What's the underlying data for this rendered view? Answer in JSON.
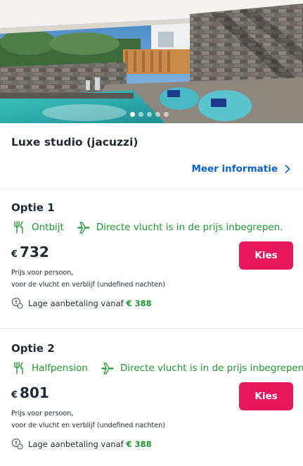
{
  "hero": {
    "image_alt_semantic": "hotel-terrace-jacuzzi-photo",
    "slides_count": 5,
    "active_slide": 1
  },
  "room": {
    "title": "Luxe studio (jacuzzi)",
    "more_info_label": "Meer informatie"
  },
  "options": [
    {
      "title": "Optie 1",
      "board": "Ontbijt",
      "flight": "Directe vlucht is in de prijs inbegrepen.",
      "currency": "€",
      "price": "732",
      "price_note_line1": "Prijs voor persoon,",
      "price_note_line2": "voor de vlucht en verblijf (undefined nachten)",
      "choose_label": "Kies",
      "deposit_label": "Lage aanbetaling vanaf",
      "deposit_amount": "€ 388"
    },
    {
      "title": "Optie 2",
      "board": "Halfpension",
      "flight": "Directe vlucht is in de prijs inbegrepen.",
      "currency": "€",
      "price": "801",
      "price_note_line1": "Prijs voor persoon,",
      "price_note_line2": "voor de vlucht en verblijf (undefined nachten)",
      "choose_label": "Kies",
      "deposit_label": "Lage aanbetaling vanaf",
      "deposit_amount": "€ 388"
    }
  ],
  "colors": {
    "accent_link": "#0a63d6",
    "cta": "#e6185b",
    "green": "#1c9a2f",
    "text": "#1f2a33"
  }
}
